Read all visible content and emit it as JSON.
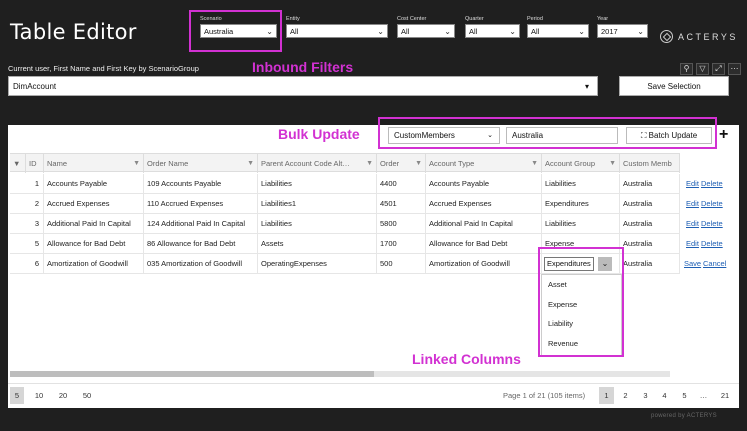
{
  "app": {
    "title": "Table Editor",
    "logo_text": "ACTERYS",
    "footer": "powered by ACTERYS"
  },
  "filters": [
    {
      "label": "Scenario",
      "value": "Australia"
    },
    {
      "label": "Entity",
      "value": "All"
    },
    {
      "label": "Cost Center",
      "value": "All"
    },
    {
      "label": "Quarter",
      "value": "All"
    },
    {
      "label": "Period",
      "value": "All"
    },
    {
      "label": "Year",
      "value": "2017"
    }
  ],
  "annotations": {
    "inbound": "Inbound Filters",
    "bulk": "Bulk Update",
    "linked": "Linked Columns",
    "color": "#d231d2"
  },
  "user_line": "Current user, First Name and First Key by ScenarioGroup",
  "toolbar_icons": [
    "pin-icon",
    "filter-icon",
    "focus-icon",
    "more-icon"
  ],
  "dimension": {
    "value": "DimAccount",
    "save_label": "Save Selection"
  },
  "bulk": {
    "member_select": "CustomMembers",
    "value": "Australia",
    "batch_label": "Batch Update",
    "add_label": "+"
  },
  "columns": [
    "ID",
    "Name",
    "Order Name",
    "Parent Account Code Alt…",
    "Order",
    "Account Type",
    "Account Group",
    "Custom Memb"
  ],
  "rows": [
    {
      "id": "1",
      "name": "Accounts Payable",
      "order_name": "109 Accounts Payable",
      "parent": "Liabilities",
      "order": "4400",
      "type": "Accounts Payable",
      "group": "Liabilities",
      "custom": "Australia",
      "a1": "Edit",
      "a2": "Delete"
    },
    {
      "id": "2",
      "name": "Accrued Expenses",
      "order_name": "110 Accrued Expenses",
      "parent": "Liabilities1",
      "order": "4501",
      "type": "Accrued Expenses",
      "group": "Expenditures",
      "custom": "Australia",
      "a1": "Edit",
      "a2": "Delete"
    },
    {
      "id": "3",
      "name": "Additional Paid In Capital",
      "order_name": "124 Additional Paid In Capital",
      "parent": "Liabilities",
      "order": "5800",
      "type": "Additional Paid In Capital",
      "group": "Liabilities",
      "custom": "Australia",
      "a1": "Edit",
      "a2": "Delete"
    },
    {
      "id": "5",
      "name": "Allowance for Bad Debt",
      "order_name": "86 Allowance for Bad Debt",
      "parent": "Assets",
      "order": "1700",
      "type": "Allowance for Bad Debt",
      "group": "Expense",
      "custom": "Australia",
      "a1": "Edit",
      "a2": "Delete"
    },
    {
      "id": "6",
      "name": "Amortization of Goodwill",
      "order_name": "035 Amortization of Goodwill",
      "parent": "OperatingExpenses",
      "order": "500",
      "type": "Amortization of Goodwill",
      "group": "",
      "custom": "Australia",
      "a1": "Save",
      "a2": "Cancel"
    }
  ],
  "editing": {
    "value": "Expenditures",
    "options": [
      "Asset",
      "Expense",
      "Liability",
      "Revenue"
    ]
  },
  "pager": {
    "sizes": [
      "5",
      "10",
      "20",
      "50"
    ],
    "info": "Page 1 of 21 (105 items)",
    "pages": [
      "1",
      "2",
      "3",
      "4",
      "5",
      "…",
      "21"
    ]
  }
}
